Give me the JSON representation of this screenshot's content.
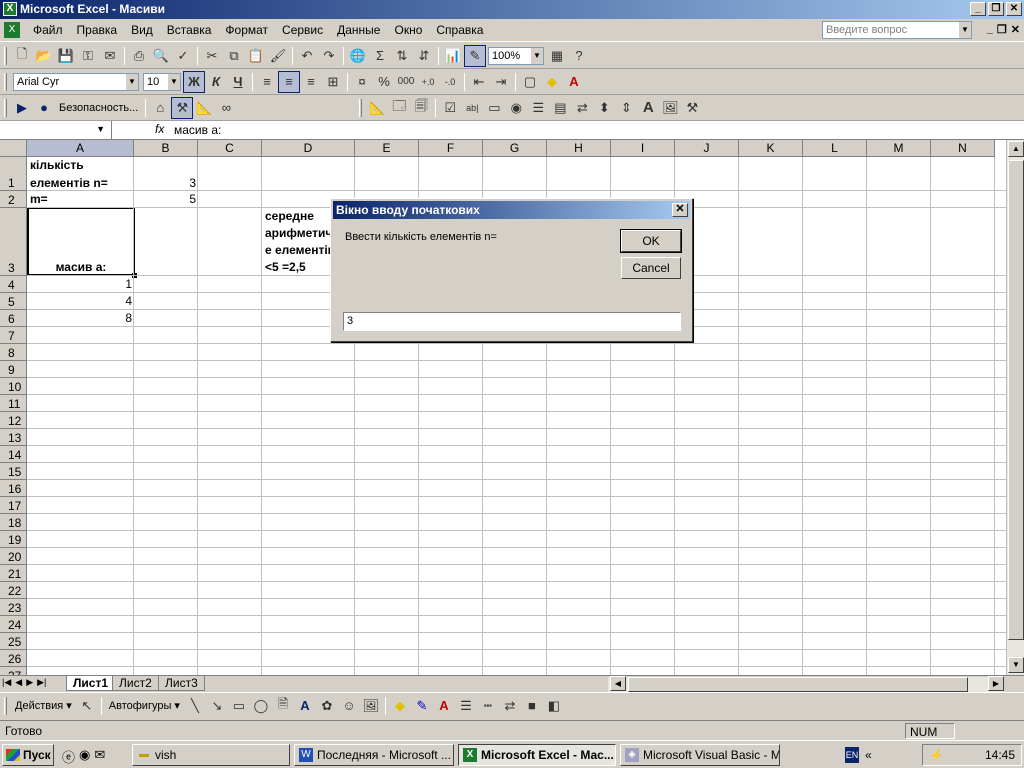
{
  "app": {
    "title": "Microsoft Excel - Масиви",
    "icon": "X"
  },
  "menu": [
    "Файл",
    "Правка",
    "Вид",
    "Вставка",
    "Формат",
    "Сервис",
    "Данные",
    "Окно",
    "Справка"
  ],
  "ask_placeholder": "Введите вопрос",
  "toolbar": {
    "zoom": "100%",
    "font_name": "Arial Cyr",
    "font_size": "10",
    "bold_label": "Ж",
    "italic_label": "К",
    "underline_label": "Ч",
    "security_label": "Безопасность..."
  },
  "formula_bar": {
    "fx": "fx",
    "content": "масив а:"
  },
  "columns": [
    "A",
    "B",
    "C",
    "D",
    "E",
    "F",
    "G",
    "H",
    "I",
    "J",
    "K",
    "L",
    "M",
    "N"
  ],
  "rows": [
    "1",
    "2",
    "3",
    "4",
    "5",
    "6",
    "7",
    "8",
    "9",
    "10",
    "11",
    "12",
    "13",
    "14",
    "15",
    "16",
    "17",
    "18",
    "19",
    "20",
    "21",
    "22",
    "23",
    "24",
    "25",
    "26",
    "27"
  ],
  "cells": {
    "A1_line1": "кількість",
    "A1_line2": "елементів n=",
    "B1": "3",
    "A2": "m=",
    "B2": "5",
    "A3": "масив а:",
    "A4": "1",
    "A5": "4",
    "A6": "8",
    "D3_line1": "середне",
    "D3_line2": "арифметичне",
    "D3_line3": "е елементів",
    "D3_line4": "<5  =2,5"
  },
  "sheets": [
    "Лист1",
    "Лист2",
    "Лист3"
  ],
  "drawing": {
    "actions_label": "Действия",
    "autoshapes_label": "Автофигуры"
  },
  "status": {
    "ready": "Готово",
    "num": "NUM"
  },
  "taskbar": {
    "start": "Пуск",
    "items": [
      "vish",
      "Последняя - Microsoft ...",
      "Microsoft Excel - Мас...",
      "Microsoft Visual Basic - M..."
    ],
    "lang": "EN",
    "clock": "14:45"
  },
  "dialog": {
    "title": "Вікно вводу початкових",
    "prompt": "Ввести кількість елементів n=",
    "ok": "OK",
    "cancel": "Cancel",
    "input_value": "3"
  }
}
